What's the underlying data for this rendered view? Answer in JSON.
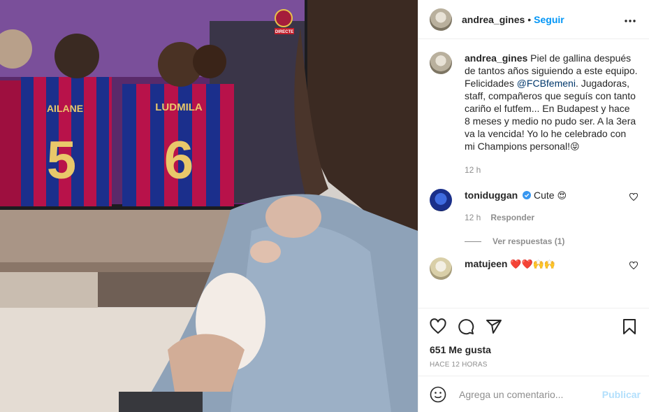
{
  "post": {
    "username": "andrea_gines",
    "follow_label": "Seguir",
    "more_label": "•••"
  },
  "caption": {
    "username": "andrea_gines",
    "text_before": "Piel de gallina después de tantos años siguiendo a este equipo. Felicidades ",
    "mention": "@FCBfemeni",
    "text_after": ". Jugadoras, staff, compañeros que seguís con tanto cariño el futfem... En Budapest y hace 8 meses y medio no pudo ser. A la 3era va la vencida! Yo lo he celebrado con mi Champions personal!",
    "emoji": "😝",
    "time": "12 h"
  },
  "comments": [
    {
      "username": "toniduggan",
      "verified": true,
      "text": "Cute",
      "emoji": "😍",
      "time": "12 h",
      "reply_label": "Responder",
      "view_replies_label": "Ver respuestas (1)"
    },
    {
      "username": "matujeen",
      "text": "",
      "emoji": "❤️❤️🙌🙌"
    }
  ],
  "likes_label": "651 Me gusta",
  "timestamp_label": "HACE 12 HORAS",
  "add_comment": {
    "placeholder": "Agrega un comentario...",
    "publish_label": "Publicar"
  },
  "media": {
    "tv_channel_badge": "DIRECTE",
    "jersey_left_name": "AILANE",
    "jersey_left_number": "5",
    "jersey_right_name": "LUDMILA",
    "jersey_right_number": "6"
  },
  "colors": {
    "accent": "#0095f6",
    "mention": "#00376b",
    "muted": "#8e8e8e",
    "publish_disabled": "#b2dffc",
    "heart_red": "#ed4956"
  },
  "icons": [
    "heart-icon",
    "comment-icon",
    "share-icon",
    "bookmark-icon",
    "emoji-icon",
    "more-icon",
    "verified-icon"
  ]
}
